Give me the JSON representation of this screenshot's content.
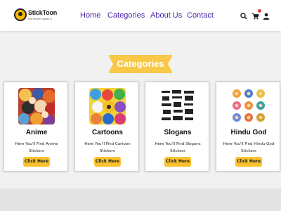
{
  "brand": {
    "name": "StickToon",
    "tagline": "Let Sticker Speak it"
  },
  "nav": {
    "links": [
      "Home",
      "Categories",
      "About Us",
      "Contact"
    ],
    "icons": [
      "search-icon",
      "cart-icon",
      "user-icon"
    ]
  },
  "colors": {
    "accent": "#f9c846",
    "nav_text": "#4b1fa8",
    "button": "#f9c22e",
    "badge": "#e53935"
  },
  "section": {
    "heading": "Categories"
  },
  "cards": [
    {
      "title": "Anime",
      "desc": "Here You'll Find Anime Stickers",
      "button": "Click Here"
    },
    {
      "title": "Cartoons",
      "desc": "Here You'll Find Cartoon Stickers",
      "button": "Click Here"
    },
    {
      "title": "Slogans",
      "desc": "Here You'll Find Slogans Stickers",
      "button": "Click Here"
    },
    {
      "title": "Hindu God",
      "desc": "Here You'll Find Hindu God Stickers",
      "button": "Click Here"
    }
  ]
}
